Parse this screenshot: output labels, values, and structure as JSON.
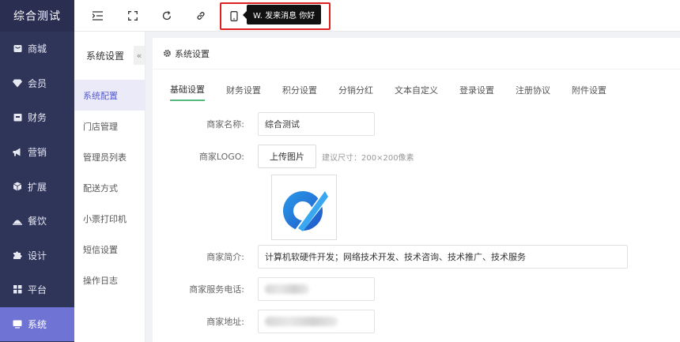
{
  "brand": "综合测试",
  "nav": [
    {
      "label": "商城",
      "icon": "mall-icon"
    },
    {
      "label": "会员",
      "icon": "diamond-icon"
    },
    {
      "label": "财务",
      "icon": "wallet-icon"
    },
    {
      "label": "营销",
      "icon": "megaphone-icon"
    },
    {
      "label": "扩展",
      "icon": "cube-icon"
    },
    {
      "label": "餐饮",
      "icon": "dish-icon"
    },
    {
      "label": "设计",
      "icon": "puzzle-icon"
    },
    {
      "label": "平台",
      "icon": "grid-icon"
    },
    {
      "label": "系统",
      "icon": "monitor-icon"
    }
  ],
  "active_nav": "系统",
  "tooltip": "W. 发来消息 你好",
  "sub": {
    "title": "系统设置",
    "collapse": "«",
    "items": [
      "系统配置",
      "门店管理",
      "管理员列表",
      "配送方式",
      "小票打印机",
      "短信设置",
      "操作日志"
    ]
  },
  "panel": {
    "title": "系统设置",
    "tabs": [
      "基础设置",
      "财务设置",
      "积分设置",
      "分销分红",
      "文本自定义",
      "登录设置",
      "注册协议",
      "附件设置"
    ]
  },
  "form": {
    "name_label": "商家名称:",
    "name_value": "综合测试",
    "logo_label": "商家LOGO:",
    "upload_label": "上传图片",
    "logo_hint": "建议尺寸：200×200像素",
    "intro_label": "商家简介:",
    "intro_value": "计算机软硬件开发；网络技术开发、技术咨询、技术推广、技术服务",
    "phone_label": "商家服务电话:",
    "address_label": "商家地址:"
  },
  "colors": {
    "sidebar": "#2f3459",
    "active_nav": "#6f73d4",
    "tab_underline": "#57b97d"
  }
}
